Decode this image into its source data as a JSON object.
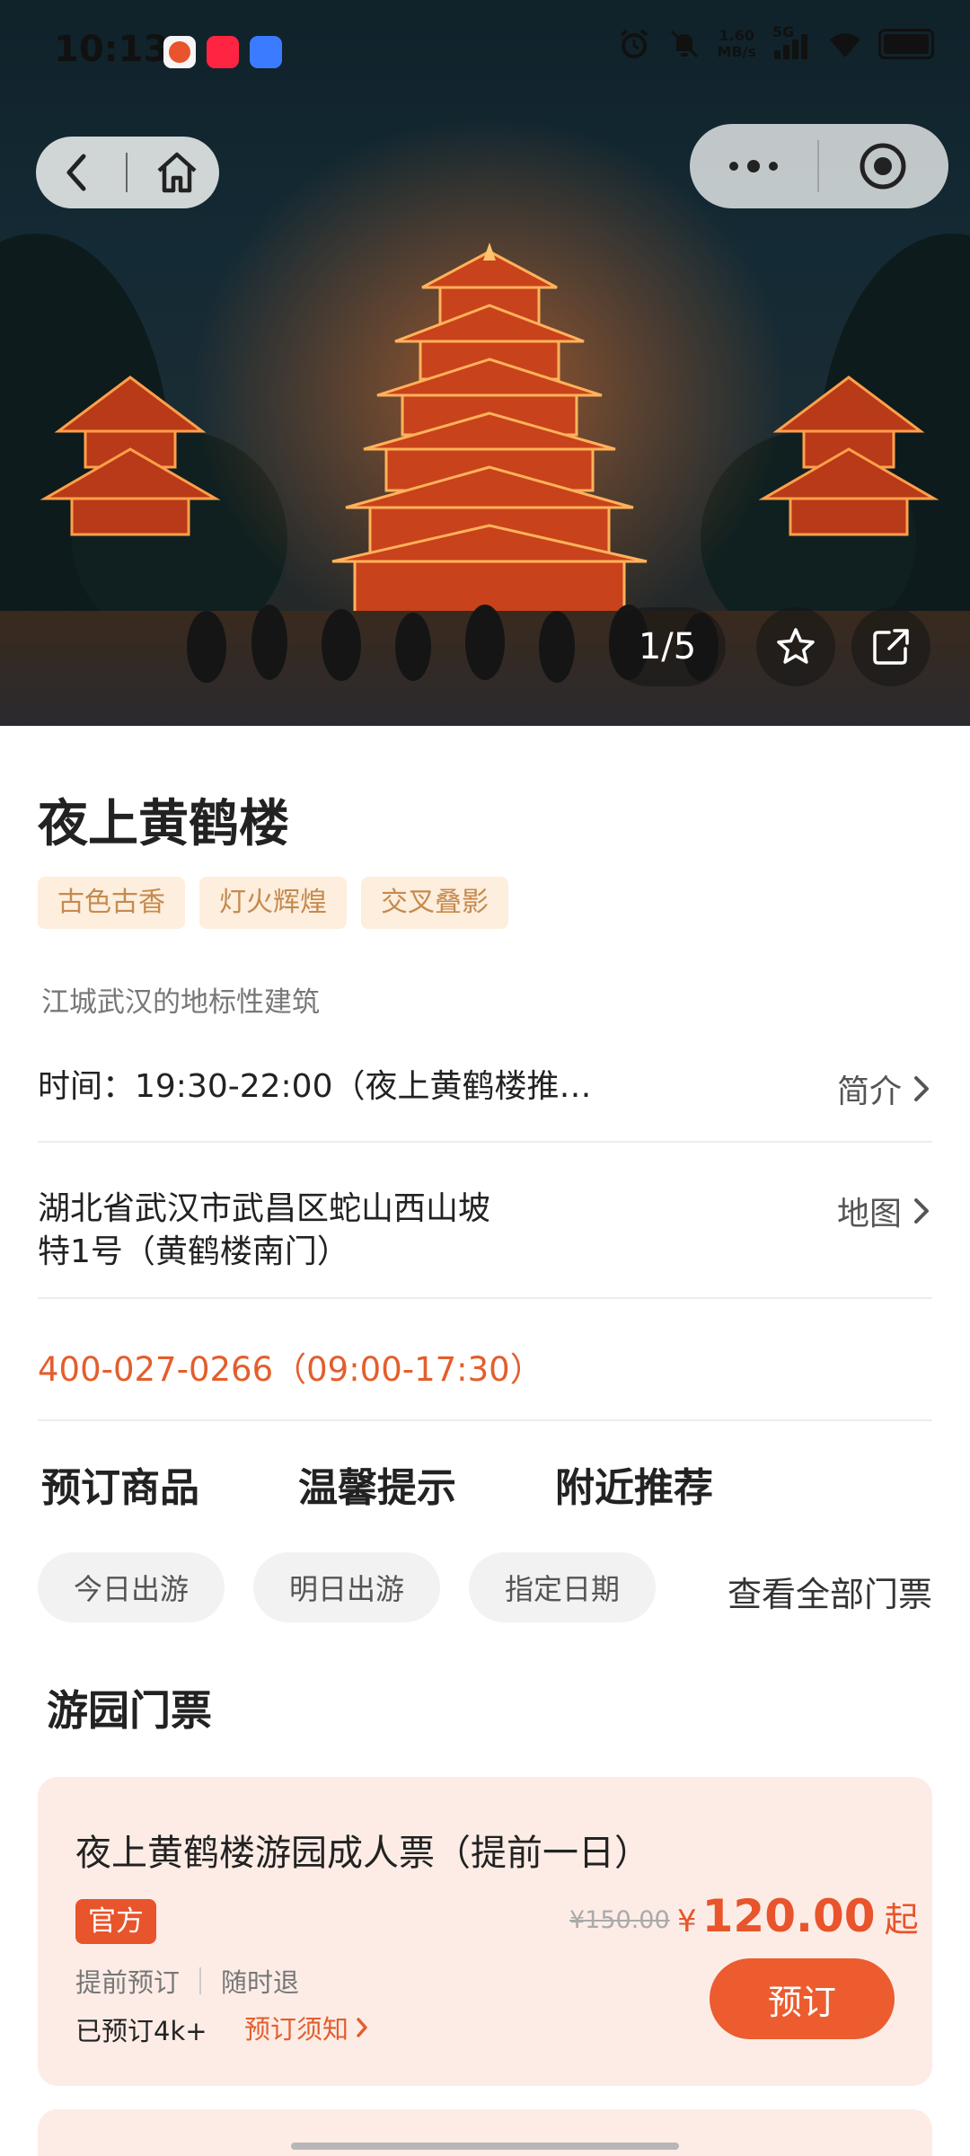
{
  "status_bar": {
    "time": "10:13",
    "net_speed_value": "1.60",
    "net_speed_unit": "MB/s",
    "signal_label": "5G"
  },
  "hero": {
    "image_counter": "1/5"
  },
  "attraction": {
    "title": "夜上黄鹤楼",
    "tags": [
      "古色古香",
      "灯火辉煌",
      "交叉叠影"
    ],
    "subtitle": "江城武汉的地标性建筑",
    "time_text": "时间：19:30-22:00（夜上黄鹤楼推…",
    "intro_link": "简介",
    "address_line1": "湖北省武汉市武昌区蛇山西山坡",
    "address_line2": "特1号（黄鹤楼南门）",
    "map_link": "地图",
    "phone": "400-027-0266（09:00-17:30）"
  },
  "section_tabs": [
    "预订商品",
    "温馨提示",
    "附近推荐"
  ],
  "date_chips": [
    "今日出游",
    "明日出游",
    "指定日期"
  ],
  "all_tickets_link": "查看全部门票",
  "ticket_section_title": "游园门票",
  "ticket": {
    "name": "夜上黄鹤楼游园成人票（提前一日）",
    "badge": "官方",
    "original_price": "¥150.00",
    "currency": "¥",
    "price": "120.00",
    "price_suffix": "起",
    "feature_1": "提前预订",
    "feature_2": "随时退",
    "sold": "已预订4k+",
    "notice_link": "预订须知",
    "book_button": "预订"
  },
  "colors": {
    "accent": "#e8542b",
    "tag_bg": "#fdeedd",
    "tag_text": "#c58a4f",
    "card_bg": "#fdece6"
  }
}
